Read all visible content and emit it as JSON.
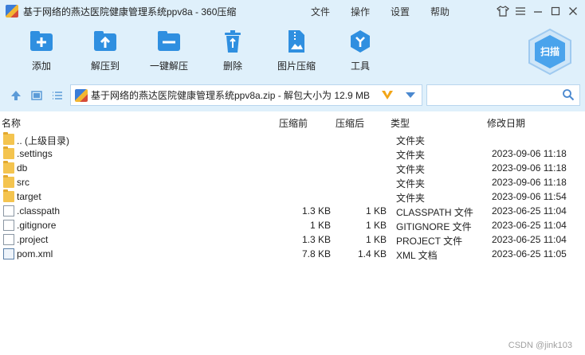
{
  "window": {
    "title": "基于网络的燕达医院健康管理系统ppv8a - 360压缩",
    "menu": [
      "文件",
      "操作",
      "设置",
      "帮助"
    ]
  },
  "toolbar": {
    "add": "添加",
    "extract_to": "解压到",
    "one_click_extract": "一键解压",
    "delete": "删除",
    "image_compress": "图片压缩",
    "tools": "工具",
    "scan": "扫描"
  },
  "address": {
    "path": "基于网络的燕达医院健康管理系统ppv8a.zip - 解包大小为 12.9 MB",
    "search_placeholder": ""
  },
  "columns": {
    "name": "名称",
    "packed": "压缩前",
    "unpacked": "压缩后",
    "type": "类型",
    "modified": "修改日期"
  },
  "files": [
    {
      "name": ".. (上级目录)",
      "packed": "",
      "unpacked": "",
      "type": "文件夹",
      "date": "",
      "kind": "folder"
    },
    {
      "name": ".settings",
      "packed": "",
      "unpacked": "",
      "type": "文件夹",
      "date": "2023-09-06 11:18",
      "kind": "folder"
    },
    {
      "name": "db",
      "packed": "",
      "unpacked": "",
      "type": "文件夹",
      "date": "2023-09-06 11:18",
      "kind": "folder"
    },
    {
      "name": "src",
      "packed": "",
      "unpacked": "",
      "type": "文件夹",
      "date": "2023-09-06 11:18",
      "kind": "folder"
    },
    {
      "name": "target",
      "packed": "",
      "unpacked": "",
      "type": "文件夹",
      "date": "2023-09-06 11:54",
      "kind": "folder"
    },
    {
      "name": ".classpath",
      "packed": "1.3 KB",
      "unpacked": "1 KB",
      "type": "CLASSPATH 文件",
      "date": "2023-06-25 11:04",
      "kind": "file"
    },
    {
      "name": ".gitignore",
      "packed": "1 KB",
      "unpacked": "1 KB",
      "type": "GITIGNORE 文件",
      "date": "2023-06-25 11:04",
      "kind": "file"
    },
    {
      "name": ".project",
      "packed": "1.3 KB",
      "unpacked": "1 KB",
      "type": "PROJECT 文件",
      "date": "2023-06-25 11:04",
      "kind": "file"
    },
    {
      "name": "pom.xml",
      "packed": "7.8 KB",
      "unpacked": "1.4 KB",
      "type": "XML 文档",
      "date": "2023-06-25 11:05",
      "kind": "xml"
    }
  ],
  "watermark": "CSDN @jink103",
  "colors": {
    "chrome_bg": "#dff0fb",
    "accent": "#2f8fe0",
    "folder": "#f4c44f"
  }
}
